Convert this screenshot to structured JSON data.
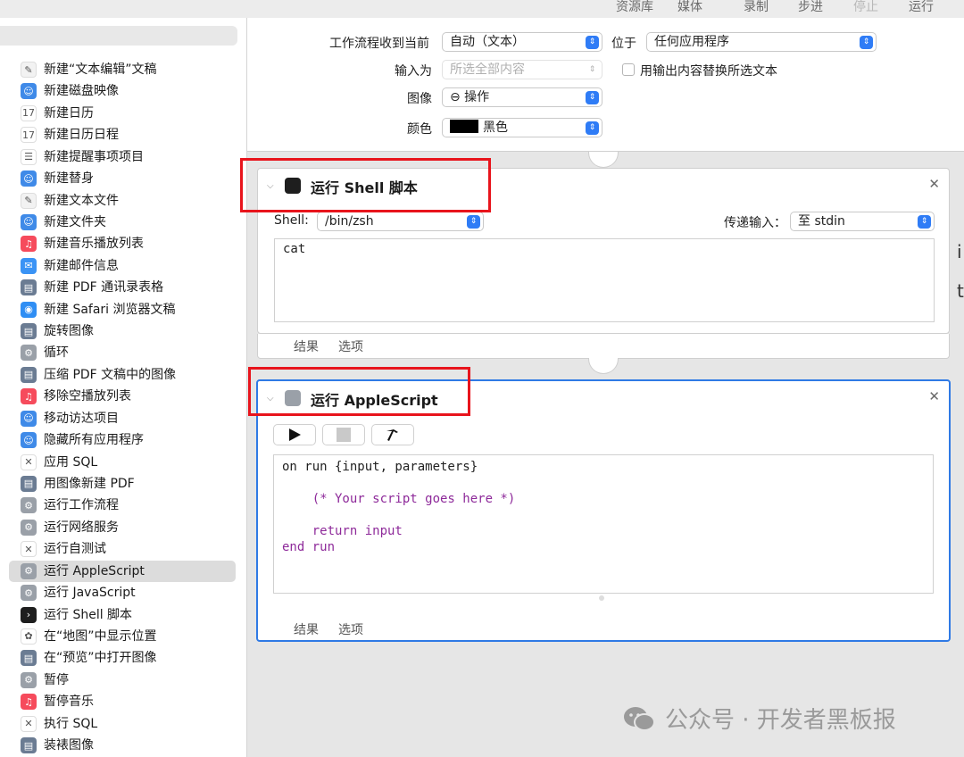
{
  "toolbar": {
    "library": "资源库",
    "media": "媒体",
    "record": "录制",
    "step": "步进",
    "stop": "停止",
    "run": "运行"
  },
  "sidebar": {
    "items": [
      {
        "label": "新建“文本编辑”文稿",
        "icon": "textedit-icon",
        "color": "#f2f2f2"
      },
      {
        "label": "新建磁盘映像",
        "icon": "finder-icon",
        "color": "#3f8ae8"
      },
      {
        "label": "新建日历",
        "icon": "calendar-icon",
        "color": "#ffffff"
      },
      {
        "label": "新建日历日程",
        "icon": "calendar-icon",
        "color": "#ffffff"
      },
      {
        "label": "新建提醒事项项目",
        "icon": "reminders-icon",
        "color": "#ffffff"
      },
      {
        "label": "新建替身",
        "icon": "finder-icon",
        "color": "#3f8ae8"
      },
      {
        "label": "新建文本文件",
        "icon": "textedit-icon",
        "color": "#f2f2f2"
      },
      {
        "label": "新建文件夹",
        "icon": "finder-icon",
        "color": "#3f8ae8"
      },
      {
        "label": "新建音乐播放列表",
        "icon": "music-icon",
        "color": "#f64b5c"
      },
      {
        "label": "新建邮件信息",
        "icon": "mail-icon",
        "color": "#3a93f5"
      },
      {
        "label": "新建 PDF 通讯录表格",
        "icon": "preview-icon",
        "color": "#6b7c93"
      },
      {
        "label": "新建 Safari 浏览器文稿",
        "icon": "safari-icon",
        "color": "#2f8ef4"
      },
      {
        "label": "旋转图像",
        "icon": "preview-icon",
        "color": "#6b7c93"
      },
      {
        "label": "循环",
        "icon": "automator-icon",
        "color": "#9aa0a8"
      },
      {
        "label": "压缩 PDF 文稿中的图像",
        "icon": "preview-icon",
        "color": "#6b7c93"
      },
      {
        "label": "移除空播放列表",
        "icon": "music-icon",
        "color": "#f64b5c"
      },
      {
        "label": "移动访达项目",
        "icon": "finder-icon",
        "color": "#3f8ae8"
      },
      {
        "label": "隐藏所有应用程序",
        "icon": "finder-icon",
        "color": "#3f8ae8"
      },
      {
        "label": "应用 SQL",
        "icon": "tools-icon",
        "color": "#ffffff"
      },
      {
        "label": "用图像新建 PDF",
        "icon": "preview-icon",
        "color": "#6b7c93"
      },
      {
        "label": "运行工作流程",
        "icon": "automator-icon",
        "color": "#9aa0a8"
      },
      {
        "label": "运行网络服务",
        "icon": "automator-icon",
        "color": "#9aa0a8"
      },
      {
        "label": "运行自测试",
        "icon": "tools-icon",
        "color": "#ffffff"
      },
      {
        "label": "运行 AppleScript",
        "icon": "automator-icon",
        "color": "#9aa0a8",
        "selected": true
      },
      {
        "label": "运行 JavaScript",
        "icon": "automator-icon",
        "color": "#9aa0a8"
      },
      {
        "label": "运行 Shell 脚本",
        "icon": "terminal-icon",
        "color": "#1e1e1e"
      },
      {
        "label": "在“地图”中显示位置",
        "icon": "photos-icon",
        "color": "#ffffff"
      },
      {
        "label": "在“预览”中打开图像",
        "icon": "preview-icon",
        "color": "#6b7c93"
      },
      {
        "label": "暂停",
        "icon": "automator-icon",
        "color": "#9aa0a8"
      },
      {
        "label": "暂停音乐",
        "icon": "music-icon",
        "color": "#f64b5c"
      },
      {
        "label": "执行 SQL",
        "icon": "tools-icon",
        "color": "#ffffff"
      },
      {
        "label": "装裱图像",
        "icon": "preview-icon",
        "color": "#6b7c93"
      }
    ]
  },
  "workflow_header": {
    "receives_label": "工作流程收到当前",
    "receives_value": "自动（文本）",
    "in_label": "位于",
    "in_value": "任何应用程序",
    "input_label": "输入为",
    "input_value": "所选全部内容",
    "replace_label": "用输出内容替换所选文本",
    "image_label": "图像",
    "image_value": "⊖ 操作",
    "color_label": "颜色",
    "color_value": "黑色"
  },
  "shell_action": {
    "title": "运行 Shell 脚本",
    "shell_label": "Shell:",
    "shell_value": "/bin/zsh",
    "pass_label": "传递输入：",
    "pass_value": "至 stdin",
    "code": "cat",
    "results": "结果",
    "options": "选项"
  },
  "applescript_action": {
    "title": "运行 AppleScript",
    "code_lines": [
      "on run {input, parameters}",
      "    (* Your script goes here *)",
      "    return input",
      "end run"
    ],
    "results": "结果",
    "options": "选项"
  },
  "watermark": "公众号 · 开发者黑板报",
  "colors": {
    "accent": "#2f7ae5",
    "highlight_red": "#e8141c",
    "code_purple": "#8e2a9a"
  }
}
